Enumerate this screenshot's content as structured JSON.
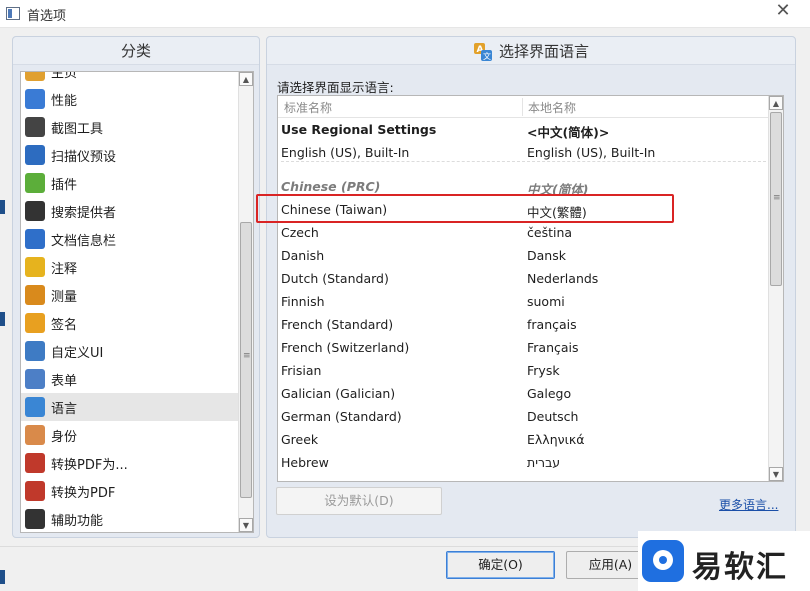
{
  "window": {
    "title": "首选项",
    "close_glyph": "✕"
  },
  "left_panel": {
    "heading": "分类",
    "items": [
      {
        "label": "主页",
        "icon": "home-icon",
        "color": "#e0a030"
      },
      {
        "label": "性能",
        "icon": "gauge-icon",
        "color": "#3a7bd5"
      },
      {
        "label": "截图工具",
        "icon": "camera-icon",
        "color": "#444444"
      },
      {
        "label": "扫描仪预设",
        "icon": "scanner-icon",
        "color": "#2d6cc0"
      },
      {
        "label": "插件",
        "icon": "puzzle-icon",
        "color": "#5cae3a"
      },
      {
        "label": "搜索提供者",
        "icon": "binoculars-icon",
        "color": "#333333"
      },
      {
        "label": "文档信息栏",
        "icon": "info-icon",
        "color": "#2f6fc9"
      },
      {
        "label": "注释",
        "icon": "note-icon",
        "color": "#e6b31e"
      },
      {
        "label": "测量",
        "icon": "ruler-icon",
        "color": "#d98a1c"
      },
      {
        "label": "签名",
        "icon": "signature-icon",
        "color": "#e8a020"
      },
      {
        "label": "自定义UI",
        "icon": "customize-icon",
        "color": "#3e7bc4"
      },
      {
        "label": "表单",
        "icon": "form-icon",
        "color": "#4d7fc6"
      },
      {
        "label": "语言",
        "icon": "language-icon",
        "color": "#3a86d4",
        "selected": true
      },
      {
        "label": "身份",
        "icon": "user-icon",
        "color": "#d98a4a"
      },
      {
        "label": "转换PDF为...",
        "icon": "pdf-export-icon",
        "color": "#c0392b"
      },
      {
        "label": "转换为PDF",
        "icon": "pdf-convert-icon",
        "color": "#c0392b"
      },
      {
        "label": "辅助功能",
        "icon": "glasses-icon",
        "color": "#333333"
      }
    ]
  },
  "right_panel": {
    "heading": "选择界面语言",
    "prompt": "请选择界面显示语言:",
    "columns": {
      "name": "标准名称",
      "native": "本地名称"
    },
    "rows": [
      {
        "name": "Use Regional Settings",
        "native": "<中文(简体)>",
        "style": "bold"
      },
      {
        "name": "English (US), Built-In",
        "native": "English (US), Built-In",
        "style": "normal"
      },
      {
        "name": "Chinese (PRC)",
        "native": "中文(简体)",
        "style": "group"
      },
      {
        "name": "Chinese (Taiwan)",
        "native": "中文(繁體)",
        "style": "normal",
        "highlighted": true
      },
      {
        "name": "Czech",
        "native": "čeština",
        "style": "normal"
      },
      {
        "name": "Danish",
        "native": "Dansk",
        "style": "normal"
      },
      {
        "name": "Dutch (Standard)",
        "native": "Nederlands",
        "style": "normal"
      },
      {
        "name": "Finnish",
        "native": "suomi",
        "style": "normal"
      },
      {
        "name": "French (Standard)",
        "native": "français",
        "style": "normal"
      },
      {
        "name": "French (Switzerland)",
        "native": "Français",
        "style": "normal"
      },
      {
        "name": "Frisian",
        "native": "Frysk",
        "style": "normal"
      },
      {
        "name": "Galician (Galician)",
        "native": "Galego",
        "style": "normal"
      },
      {
        "name": "German (Standard)",
        "native": "Deutsch",
        "style": "normal"
      },
      {
        "name": "Greek",
        "native": "Ελληνικά",
        "style": "normal"
      },
      {
        "name": "Hebrew",
        "native": "עברית",
        "style": "normal"
      }
    ],
    "set_default_label": "设为默认(D)",
    "more_languages_label": "更多语言...",
    "highlight_color": "#d92424"
  },
  "footer": {
    "ok_label": "确定(O)",
    "apply_label": "应用(A)"
  },
  "watermark": {
    "text": "易软汇",
    "brand_color": "#1f6fe0"
  }
}
